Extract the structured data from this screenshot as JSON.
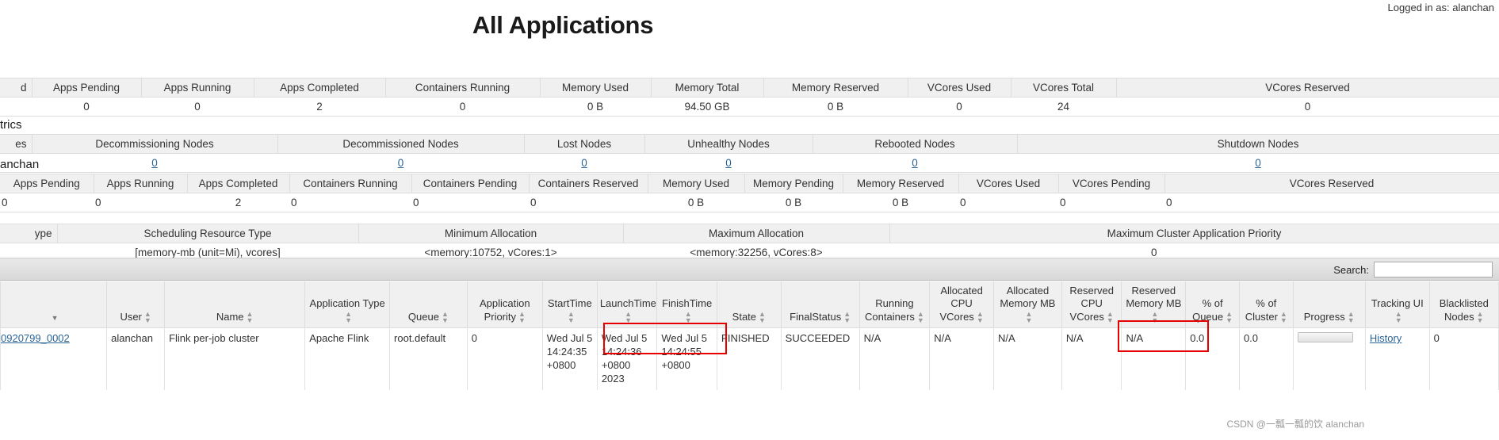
{
  "header": {
    "logged_in": "Logged in as: alanchan",
    "title": "All Applications"
  },
  "cluster_metrics": {
    "section_label_partial": "d",
    "headers": [
      "Apps Pending",
      "Apps Running",
      "Apps Completed",
      "Containers Running",
      "Memory Used",
      "Memory Total",
      "Memory Reserved",
      "VCores Used",
      "VCores Total",
      "VCores Reserved"
    ],
    "values": [
      "0",
      "0",
      "2",
      "0",
      "0 B",
      "94.50 GB",
      "0 B",
      "0",
      "24",
      "0"
    ]
  },
  "node_metrics": {
    "section_label": "trics",
    "headers": [
      "es",
      "Decommissioning Nodes",
      "Decommissioned Nodes",
      "Lost Nodes",
      "Unhealthy Nodes",
      "Rebooted Nodes",
      "Shutdown Nodes"
    ],
    "values": [
      "",
      "0",
      "0",
      "0",
      "0",
      "0",
      "0"
    ]
  },
  "user_metrics": {
    "section_label": "anchan",
    "headers": [
      "Apps Pending",
      "Apps Running",
      "Apps Completed",
      "Containers Running",
      "Containers Pending",
      "Containers Reserved",
      "Memory Used",
      "Memory Pending",
      "Memory Reserved",
      "VCores Used",
      "VCores Pending",
      "VCores Reserved"
    ],
    "values": [
      "0",
      "0",
      "2",
      "0",
      "0",
      "0",
      "0 B",
      "0 B",
      "0 B",
      "0",
      "0",
      "0"
    ]
  },
  "scheduler_metrics": {
    "headers": [
      "ype",
      "Scheduling Resource Type",
      "Minimum Allocation",
      "Maximum Allocation",
      "Maximum Cluster Application Priority"
    ],
    "values": [
      "",
      "[memory-mb (unit=Mi), vcores]",
      "<memory:10752, vCores:1>",
      "<memory:32256, vCores:8>",
      "0"
    ]
  },
  "apps_toolbar": {
    "search_label": "Search:",
    "search_value": "",
    "search_placeholder": ""
  },
  "apps_table": {
    "columns": [
      {
        "label": "",
        "sort": "desc"
      },
      {
        "label": "User",
        "sort": "both"
      },
      {
        "label": "Name",
        "sort": "both"
      },
      {
        "label": "Application Type",
        "sort": "both"
      },
      {
        "label": "Queue",
        "sort": "both"
      },
      {
        "label": "Application Priority",
        "sort": "both"
      },
      {
        "label": "StartTime",
        "sort": "both"
      },
      {
        "label": "LaunchTime",
        "sort": "both"
      },
      {
        "label": "FinishTime",
        "sort": "both"
      },
      {
        "label": "State",
        "sort": "both"
      },
      {
        "label": "FinalStatus",
        "sort": "both"
      },
      {
        "label": "Running Containers",
        "sort": "both"
      },
      {
        "label": "Allocated CPU VCores",
        "sort": "both"
      },
      {
        "label": "Allocated Memory MB",
        "sort": "both"
      },
      {
        "label": "Reserved CPU VCores",
        "sort": "both"
      },
      {
        "label": "Reserved Memory MB",
        "sort": "both"
      },
      {
        "label": "% of Queue",
        "sort": "both"
      },
      {
        "label": "% of Cluster",
        "sort": "both"
      },
      {
        "label": "Progress",
        "sort": "both"
      },
      {
        "label": "Tracking UI",
        "sort": "both"
      },
      {
        "label": "Blacklisted Nodes",
        "sort": "both"
      }
    ],
    "rows": [
      {
        "id": "0920799_0002",
        "user": "alanchan",
        "name": "Flink per-job cluster",
        "app_type": "Apache Flink",
        "queue": "root.default",
        "priority": "0",
        "start_time": [
          "Wed Jul 5",
          "14:24:35",
          "+0800"
        ],
        "launch_time": [
          "Wed Jul 5",
          "14:24:36",
          "+0800 2023"
        ],
        "finish_time": [
          "Wed Jul 5",
          "14:24:55",
          "+0800"
        ],
        "state": "FINISHED",
        "final_status": "SUCCEEDED",
        "running_containers": "N/A",
        "allocated_cpu_vcores": "N/A",
        "allocated_memory_mb": "N/A",
        "reserved_cpu_vcores": "N/A",
        "reserved_memory_mb": "N/A",
        "pct_queue": "0.0",
        "pct_cluster": "0.0",
        "progress": "",
        "tracking_ui": "History",
        "blacklisted_nodes": "0"
      }
    ]
  },
  "watermark": "CSDN @一瓢一瓢的饮 alanchan",
  "colors": {
    "accent_link": "#2a6496",
    "annotation": "#e60000",
    "header_bg": "#f0f0f0"
  }
}
